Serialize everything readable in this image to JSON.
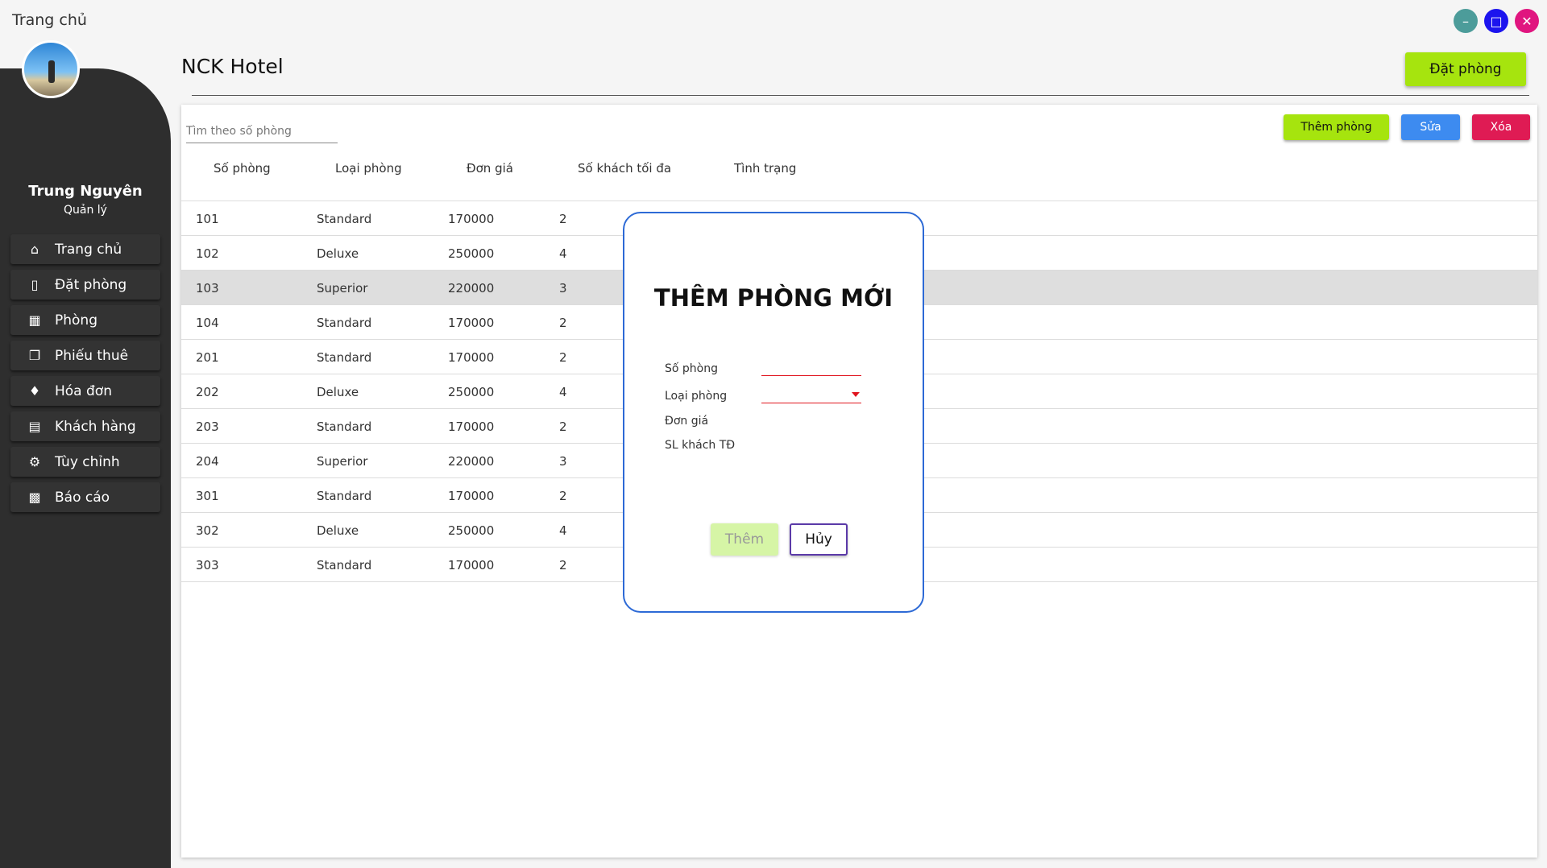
{
  "window": {
    "title": "Trang chủ"
  },
  "user": {
    "name": "Trung Nguyên",
    "role": "Quản lý"
  },
  "sidebar": {
    "items": [
      {
        "label": "Trang chủ",
        "icon": "home-icon"
      },
      {
        "label": "Đặt phòng",
        "icon": "phone-icon"
      },
      {
        "label": "Phòng",
        "icon": "building-icon"
      },
      {
        "label": "Phiếu thuê",
        "icon": "clipboard-icon"
      },
      {
        "label": "Hóa đơn",
        "icon": "cards-icon"
      },
      {
        "label": "Khách hàng",
        "icon": "id-card-icon"
      },
      {
        "label": "Tùy chỉnh",
        "icon": "gear-icon"
      },
      {
        "label": "Báo cáo",
        "icon": "bar-chart-icon"
      }
    ]
  },
  "header": {
    "title": "NCK Hotel",
    "book_button": "Đặt phòng"
  },
  "toolbar": {
    "search_placeholder": "Tìm theo số phòng",
    "add_label": "Thêm phòng",
    "edit_label": "Sửa",
    "delete_label": "Xóa"
  },
  "table": {
    "columns": [
      "Số phòng",
      "Loại phòng",
      "Đơn giá",
      "Số khách tối đa",
      "Tình trạng"
    ],
    "rows": [
      [
        "101",
        "Standard",
        "170000",
        "2"
      ],
      [
        "102",
        "Deluxe",
        "250000",
        "4"
      ],
      [
        "103",
        "Superior",
        "220000",
        "3"
      ],
      [
        "104",
        "Standard",
        "170000",
        "2"
      ],
      [
        "201",
        "Standard",
        "170000",
        "2"
      ],
      [
        "202",
        "Deluxe",
        "250000",
        "4"
      ],
      [
        "203",
        "Standard",
        "170000",
        "2"
      ],
      [
        "204",
        "Superior",
        "220000",
        "3"
      ],
      [
        "301",
        "Standard",
        "170000",
        "2"
      ],
      [
        "302",
        "Deluxe",
        "250000",
        "4"
      ],
      [
        "303",
        "Standard",
        "170000",
        "2"
      ]
    ]
  },
  "dialog": {
    "title": "THÊM PHÒNG MỚI",
    "labels": {
      "room_number": "Số phòng",
      "room_type": "Loại phòng",
      "price": "Đơn giá",
      "max_guests": "SL khách TĐ"
    },
    "add_label": "Thêm",
    "cancel_label": "Hủy"
  },
  "colors": {
    "accent_green": "#a6e40e",
    "edit_blue": "#3d8bf0",
    "delete_red": "#df1b54",
    "dialog_border": "#2d6ad6",
    "field_error": "#e0151f"
  }
}
